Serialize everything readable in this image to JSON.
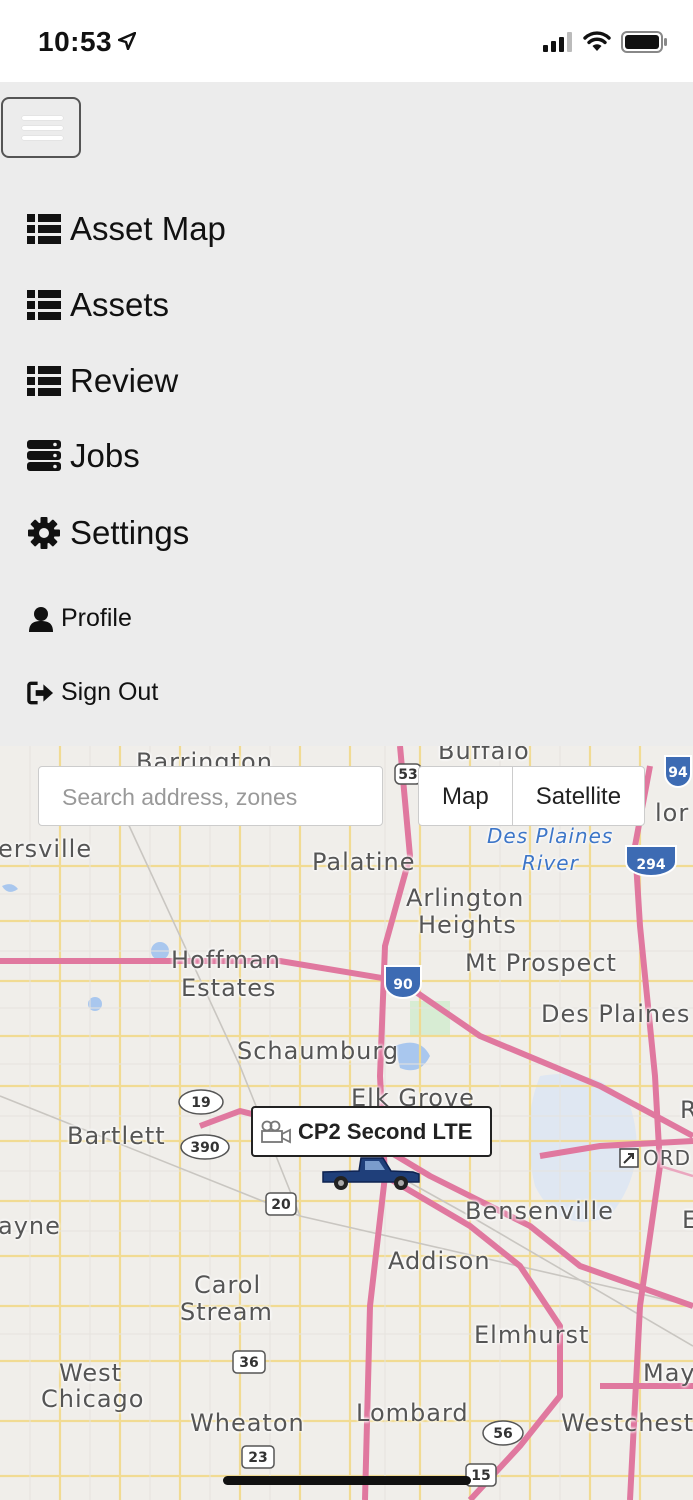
{
  "status_bar": {
    "time": "10:53",
    "icons": [
      "location-arrow-icon",
      "cellular-signal-icon",
      "wifi-icon",
      "battery-icon"
    ]
  },
  "nav": {
    "toggle_icon": "hamburger-menu-icon",
    "items": [
      {
        "label": "Asset Map",
        "icon": "list-icon"
      },
      {
        "label": "Assets",
        "icon": "list-icon"
      },
      {
        "label": "Review",
        "icon": "list-icon"
      },
      {
        "label": "Jobs",
        "icon": "server-icon"
      },
      {
        "label": "Settings",
        "icon": "gear-icon"
      },
      {
        "label": "Profile",
        "icon": "user-icon"
      },
      {
        "label": "Sign Out",
        "icon": "sign-out-icon"
      }
    ]
  },
  "map": {
    "search_placeholder": "Search address, zones",
    "type_buttons": [
      "Map",
      "Satellite"
    ],
    "asset": {
      "label": "CP2 Second LTE",
      "icon": "video-camera-icon",
      "vehicle_icon": "pickup-truck-icon"
    },
    "places": [
      "Barrington",
      "Buffalo",
      "Des Plaines",
      "River",
      "ersville",
      "Palatine",
      "Arlington",
      "Heights",
      "Hoffman",
      "Estates",
      "Mt Prospect",
      "Des Plaines",
      "Schaumburg",
      "Elk Grove",
      "Bartlett",
      "ORD",
      "Bensenville",
      "ayne",
      "Addison",
      "Carol",
      "Stream",
      "Elmhurst",
      "West",
      "Chicago",
      "Wheaton",
      "Lombard",
      "Westcheste",
      "May",
      "lor",
      "R",
      "E"
    ],
    "route_shields": [
      "53",
      "94",
      "294",
      "90",
      "19",
      "390",
      "20",
      "36",
      "56",
      "23",
      "15"
    ]
  },
  "colors": {
    "nav_background": "#ececec",
    "highway": "#e0789f",
    "road": "#f2d98a",
    "water": "#a9c7ee",
    "truck": "#1f3f7a"
  }
}
